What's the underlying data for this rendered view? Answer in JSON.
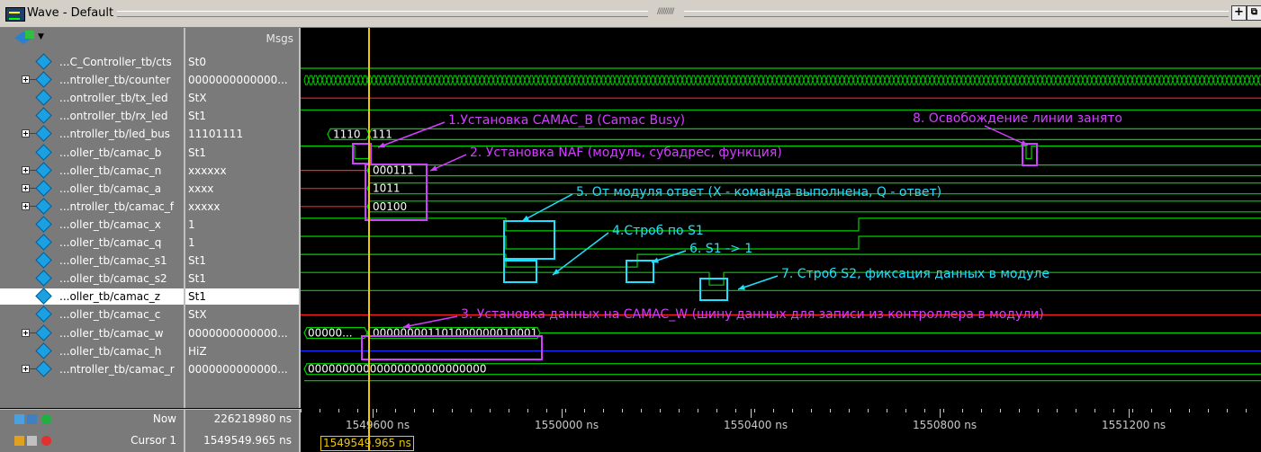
{
  "window": {
    "title": "Wave - Default"
  },
  "header": {
    "msgs_label": "Msgs"
  },
  "signals": [
    {
      "name": "...C_Controller_tb/cts",
      "value": "St0",
      "expandable": false
    },
    {
      "name": "...ntroller_tb/counter",
      "value": "0000000000000...",
      "expandable": true
    },
    {
      "name": "...ontroller_tb/tx_led",
      "value": "StX",
      "expandable": false
    },
    {
      "name": "...ontroller_tb/rx_led",
      "value": "St1",
      "expandable": false
    },
    {
      "name": "...ntroller_tb/led_bus",
      "value": "11101111",
      "expandable": true
    },
    {
      "name": "...oller_tb/camac_b",
      "value": "St1",
      "expandable": false
    },
    {
      "name": "...oller_tb/camac_n",
      "value": "xxxxxx",
      "expandable": true
    },
    {
      "name": "...oller_tb/camac_a",
      "value": "xxxx",
      "expandable": true
    },
    {
      "name": "...ntroller_tb/camac_f",
      "value": "xxxxx",
      "expandable": true
    },
    {
      "name": "...oller_tb/camac_x",
      "value": "1",
      "expandable": false
    },
    {
      "name": "...oller_tb/camac_q",
      "value": "1",
      "expandable": false
    },
    {
      "name": "...oller_tb/camac_s1",
      "value": "St1",
      "expandable": false
    },
    {
      "name": "...oller_tb/camac_s2",
      "value": "St1",
      "expandable": false
    },
    {
      "name": "...oller_tb/camac_z",
      "value": "St1",
      "expandable": false,
      "selected": true
    },
    {
      "name": "...oller_tb/camac_c",
      "value": "StX",
      "expandable": false
    },
    {
      "name": "...oller_tb/camac_w",
      "value": "0000000000000...",
      "expandable": true
    },
    {
      "name": "...oller_tb/camac_h",
      "value": "HiZ",
      "expandable": false
    },
    {
      "name": "...ntroller_tb/camac_r",
      "value": "0000000000000...",
      "expandable": true
    }
  ],
  "wave_labels": {
    "led_bus_before": "1110",
    "led_bus_after": "111",
    "camac_n": "000111",
    "camac_a": "1011",
    "camac_f": "00100",
    "camac_w_before": "00000...",
    "camac_w_after": "000000001101000000010001",
    "camac_r_before": "00000000",
    "camac_r_after": "000000000000000000"
  },
  "annotations": [
    {
      "id": "a1",
      "text": "1.Установка CAMAC_B (Camac Busy)",
      "color": "#d040ff"
    },
    {
      "id": "a2",
      "text": "2. Установка NAF (модуль, субадрес, функция)",
      "color": "#d040ff"
    },
    {
      "id": "a3",
      "text": "3. Установка данных на CAMAC_W (шину данных для записи из контроллера в модули)",
      "color": "#d040ff"
    },
    {
      "id": "a4",
      "text": "4.Строб по S1",
      "color": "#20e0ff"
    },
    {
      "id": "a5",
      "text": "5. От модуля ответ (X - команда выполнена, Q - ответ)",
      "color": "#20e0ff"
    },
    {
      "id": "a6",
      "text": "6. S1 -> 1",
      "color": "#20e0ff"
    },
    {
      "id": "a7",
      "text": "7. Строб S2, фиксация данных в модуле",
      "color": "#20e0ff"
    },
    {
      "id": "a8",
      "text": "8. Освобождение линии занято",
      "color": "#d040ff"
    }
  ],
  "footer": {
    "now_label": "Now",
    "now_value": "226218980 ns",
    "cursor_label": "Cursor 1",
    "cursor_value": "1549549.965 ns",
    "cursor_readout": "1549549.965 ns",
    "time_ticks": [
      "1549600 ns",
      "1550000 ns",
      "1550400 ns",
      "1550800 ns",
      "1551200 ns"
    ]
  },
  "colors": {
    "green": "#00d000",
    "red": "#ff2020",
    "blue": "#2030ff",
    "cursor": "#f0c800",
    "magenta": "#d040ff",
    "cyan": "#20e0ff"
  }
}
